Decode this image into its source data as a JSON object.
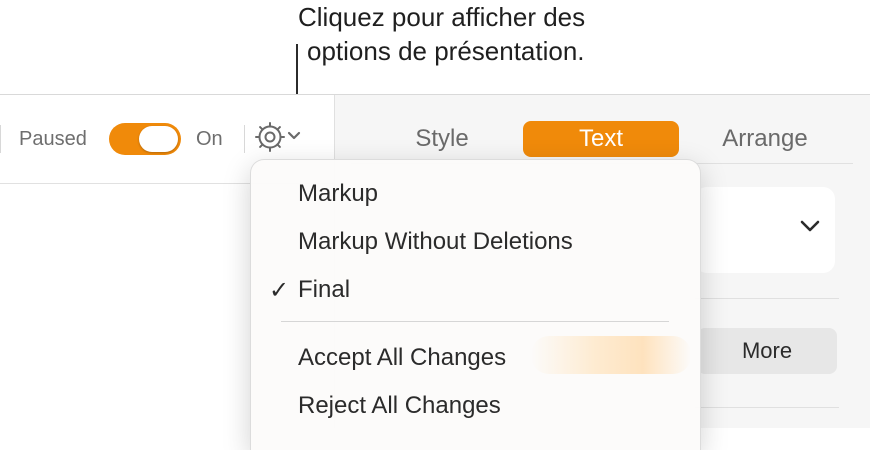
{
  "callout": {
    "line1": "Cliquez pour afficher des",
    "line2": "options de présentation."
  },
  "toolbar": {
    "paused_label": "Paused",
    "toggle_on": true,
    "on_label": "On",
    "gear_icon": "gear-icon",
    "chevron_icon": "chevron-down-icon"
  },
  "sidebar": {
    "tabs": [
      {
        "label": "Style",
        "selected": false
      },
      {
        "label": "Text",
        "selected": true
      },
      {
        "label": "Arrange",
        "selected": false
      }
    ],
    "more_label": "More",
    "dropdown_icon": "chevron-down-icon"
  },
  "menu": {
    "items": [
      {
        "label": "Markup",
        "checked": false
      },
      {
        "label": "Markup Without Deletions",
        "checked": false
      },
      {
        "label": "Final",
        "checked": true
      },
      {
        "label": "Accept All Changes",
        "checked": false
      },
      {
        "label": "Reject All Changes",
        "checked": false
      }
    ],
    "check_mark": "✓"
  },
  "colors": {
    "accent": "#f08a0a",
    "sidebar_bg": "#f6f6f6",
    "text": "#2b2b2b",
    "muted_text": "#6e6e6e"
  }
}
